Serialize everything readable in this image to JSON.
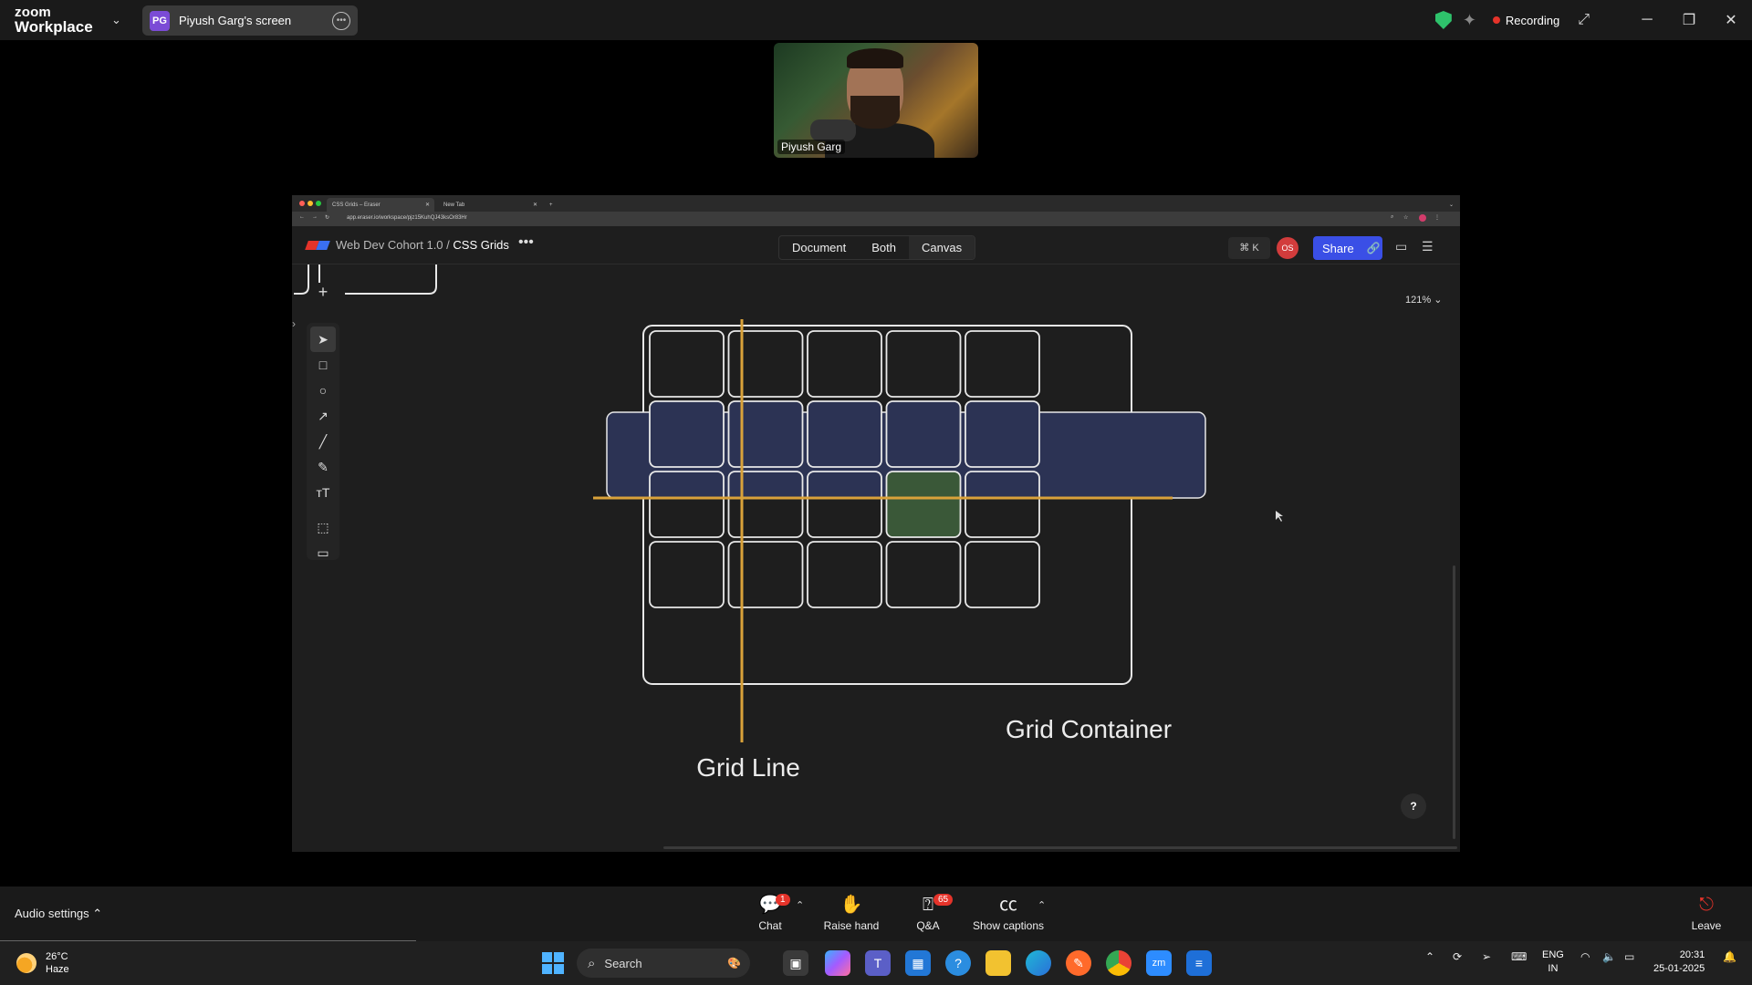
{
  "zoom": {
    "brand_line1": "zoom",
    "brand_line2": "Workplace",
    "screen_label": "Piyush Garg's screen",
    "screen_badge": "PG",
    "recording_label": "Recording",
    "participant_name": "Piyush Garg"
  },
  "browser": {
    "tabs": [
      {
        "label": "CSS Grids – Eraser"
      },
      {
        "label": "New Tab"
      }
    ],
    "url": "app.eraser.io/workspace/pjz15KuhQJ43ksOr83Hr"
  },
  "eraser": {
    "breadcrumb_parent": "Web Dev Cohort 1.0",
    "breadcrumb_sep": "/",
    "breadcrumb_current": "CSS Grids",
    "view_modes": [
      "Document",
      "Both",
      "Canvas"
    ],
    "selected_view": "Canvas",
    "shortcut_label": "⌘ K",
    "avatar_initials": "OS",
    "share_label": "Share",
    "zoom_level": "121%",
    "help_label": "?",
    "brand_colors": {
      "accent": "#3a4fe6",
      "avatar": "#d23c3c"
    }
  },
  "diagram": {
    "labels": {
      "grid_line": "Grid Line",
      "grid_container": "Grid Container"
    },
    "grid": {
      "rows": 4,
      "columns": 5,
      "highlighted_row": 2,
      "highlighted_cell": {
        "row": 3,
        "column": 4
      }
    },
    "colors": {
      "highlight_row": "#2c3354",
      "highlight_cell": "#3a5838",
      "grid_line": "#d9a23a",
      "stroke": "#e8e8e8"
    }
  },
  "zoom_controls": {
    "audio_settings": "Audio settings",
    "chat": "Chat",
    "chat_badge": "1",
    "raise_hand": "Raise hand",
    "qa": "Q&A",
    "qa_badge": "65",
    "captions": "Show captions",
    "leave": "Leave"
  },
  "taskbar": {
    "temperature": "26°C",
    "weather": "Haze",
    "search_placeholder": "Search",
    "lang_line1": "ENG",
    "lang_line2": "IN",
    "time": "20:31",
    "date": "25-01-2025"
  }
}
